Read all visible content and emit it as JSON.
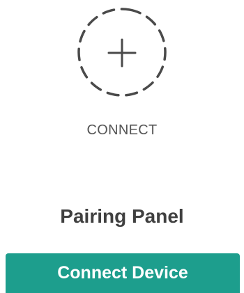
{
  "connect": {
    "icon": "dashed-plus-circle-icon",
    "label": "CONNECT"
  },
  "panel": {
    "title": "Pairing Panel"
  },
  "actions": {
    "connect_device_label": "Connect Device"
  },
  "colors": {
    "accent": "#1d9e8d",
    "icon_stroke": "#4a4a4a",
    "label_text": "#555555",
    "title_text": "#404040"
  }
}
